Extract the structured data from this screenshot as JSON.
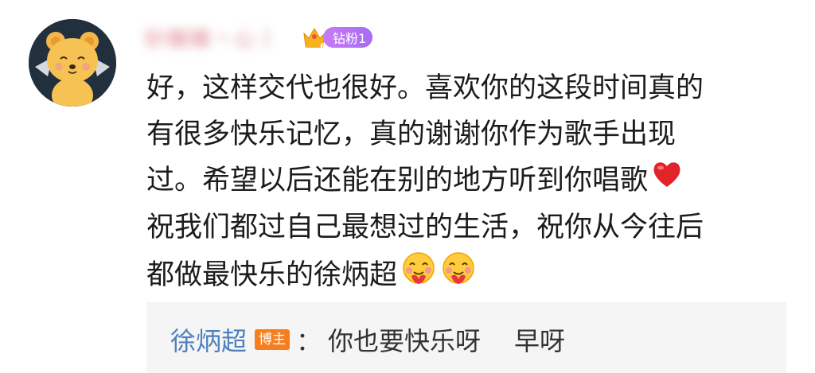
{
  "comment": {
    "username": "砂糖糖丶心丨",
    "fan_badge": {
      "level": "6",
      "label": "钻粉1"
    },
    "lines": [
      "好，这样交代也很好。喜欢你的这段时间真的",
      "有很多快乐记忆，真的谢谢你作为歌手出现",
      "过。希望以后还能在别的地方听到你唱歌",
      "祝我们都过自己最想过的生活，祝你从今往后",
      "都做最快乐的徐炳超"
    ],
    "emojis": {
      "line3": "red-heart",
      "line5": [
        "hugging-face",
        "hugging-face"
      ]
    }
  },
  "reply": {
    "author": "徐炳超",
    "author_badge": "博主",
    "separator": "：",
    "text": "你也要快乐呀",
    "text2": "早呀"
  },
  "colors": {
    "reply_author": "#4f7fbf",
    "host_badge": "#f57e1f",
    "fan_pill": "#b774f5",
    "reply_bg": "#f5f5f5"
  }
}
